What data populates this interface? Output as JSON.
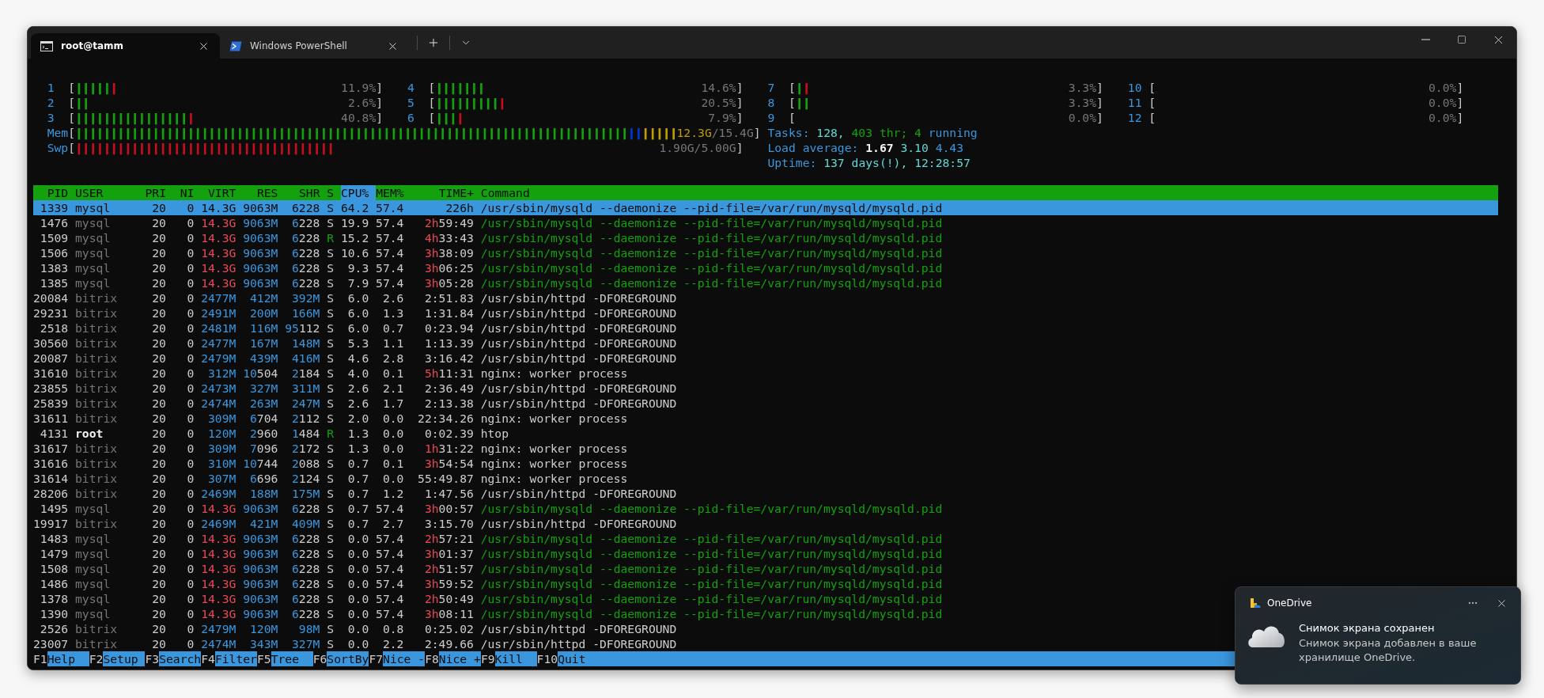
{
  "tabs": [
    {
      "title": "root@tamm",
      "kind": "cmd",
      "selected": true
    },
    {
      "title": "Windows PowerShell",
      "kind": "powershell",
      "selected": false
    }
  ],
  "meter_panels": [
    {
      "cpus": [
        {
          "label": "1",
          "open": "[",
          "close": "]",
          "reading": "11.9%",
          "segments": [
            {
              "color": "#13a10e",
              "text": "|||||"
            },
            {
              "color": "#c50f1f",
              "text": "|"
            }
          ]
        },
        {
          "label": "2",
          "open": "[",
          "close": "]",
          "reading": "2.6%",
          "segments": [
            {
              "color": "#13a10e",
              "text": "||"
            }
          ]
        },
        {
          "label": "3",
          "open": "[",
          "close": "]",
          "reading": "40.8%",
          "segments": [
            {
              "color": "#13a10e",
              "text": "||||||||||||||||"
            },
            {
              "color": "#c50f1f",
              "text": "|"
            }
          ]
        },
        {
          "label": "4",
          "open": "[",
          "close": "]",
          "reading": "14.6%",
          "segments": [
            {
              "color": "#13a10e",
              "text": "|||||||"
            }
          ]
        },
        {
          "label": "5",
          "open": "[",
          "close": "]",
          "reading": "20.5%",
          "segments": [
            {
              "color": "#13a10e",
              "text": "|||||||||"
            },
            {
              "color": "#c50f1f",
              "text": "|"
            }
          ]
        },
        {
          "label": "6",
          "open": "[",
          "close": "]",
          "reading": "7.9%",
          "segments": [
            {
              "color": "#13a10e",
              "text": "|||"
            },
            {
              "color": "#c50f1f",
              "text": "|"
            }
          ]
        }
      ],
      "bars": [
        {
          "label": "Mem",
          "open": "[",
          "close": "]",
          "reading_filled": "12.3G",
          "reading": "/15.4G",
          "segments": [
            {
              "color": "#13a10e",
              "text": "|||||||||||||||||||||||||||||||||||||||||||||||||||||||||||||||||||||||||||||||"
            },
            {
              "color": "#0037da",
              "text": "||"
            },
            {
              "color": "#c19c00",
              "text": "|||||"
            }
          ]
        },
        {
          "label": "Swp",
          "open": "[",
          "close": "]",
          "reading": "1.90G/5.00G",
          "segments": [
            {
              "color": "#c50f1f",
              "text": "|||||||||||||||||||||||||||||||||||||"
            }
          ]
        }
      ]
    },
    {
      "cpus": [
        {
          "label": "7",
          "open": "[",
          "close": "]",
          "reading": "3.3%",
          "segments": [
            {
              "color": "#13a10e",
              "text": "|"
            },
            {
              "color": "#c50f1f",
              "text": "|"
            }
          ]
        },
        {
          "label": "8",
          "open": "[",
          "close": "]",
          "reading": "3.3%",
          "segments": [
            {
              "color": "#13a10e",
              "text": "||"
            }
          ]
        },
        {
          "label": "9",
          "open": "[",
          "close": "]",
          "reading": "0.0%"
        },
        {
          "label": "10",
          "open": "[",
          "close": "]",
          "reading": "0.0%"
        },
        {
          "label": "11",
          "open": "[",
          "close": "]",
          "reading": "0.0%"
        },
        {
          "label": "12",
          "open": "[",
          "close": "]",
          "reading": "0.0%"
        }
      ],
      "summary": [
        {
          "parts": [
            {
              "text": "Tasks:",
              "kind": "label"
            },
            {
              "text": "128,",
              "kind": "value"
            },
            {
              "text": "403 thr;",
              "kind": "accent"
            },
            {
              "text": "4",
              "kind": "accent"
            },
            {
              "text": "running",
              "kind": "label"
            }
          ]
        },
        {
          "parts": [
            {
              "text": "Load average:",
              "kind": "label"
            },
            {
              "text": "1.67",
              "kind": "strong"
            },
            {
              "text": "3.10",
              "kind": "value"
            },
            {
              "text": "4.43",
              "kind": "label"
            }
          ]
        },
        {
          "parts": [
            {
              "text": "Uptime:",
              "kind": "label"
            },
            {
              "text": "137 days(!), 12:28:57",
              "kind": "value"
            }
          ]
        }
      ]
    }
  ],
  "table": {
    "columns": [
      {
        "label": "PID",
        "selected": false
      },
      {
        "label": "USER",
        "selected": false
      },
      {
        "label": "PRI",
        "selected": false
      },
      {
        "label": "NI",
        "selected": false
      },
      {
        "label": "VIRT",
        "selected": false
      },
      {
        "label": "RES",
        "selected": false
      },
      {
        "label": "SHR",
        "selected": false
      },
      {
        "label": "S",
        "selected": false
      },
      {
        "label": "CPU%",
        "selected": true
      },
      {
        "label": "MEM%",
        "selected": false
      },
      {
        "label": "TIME+",
        "selected": false
      },
      {
        "label": "Command",
        "selected": false
      }
    ],
    "rows": [
      {
        "pid": "1339",
        "user": "mysql",
        "pri": "20",
        "ni": "0",
        "virt": "14.3G",
        "res": "9063M",
        "shr": "6228",
        "s": "S",
        "cpu": "64.2",
        "mem": "57.4",
        "time": "226h",
        "command": "/usr/sbin/mysqld --daemonize --pid-file=/var/run/mysqld/mysqld.pid",
        "kind": "process",
        "own": false,
        "running": false,
        "selected": true
      },
      {
        "pid": "1476",
        "user": "mysql",
        "pri": "20",
        "ni": "0",
        "virt": "14.3G",
        "res": "9063M",
        "shr": "6228",
        "s": "S",
        "cpu": "19.9",
        "mem": "57.4",
        "time": "2h59:49",
        "command": "/usr/sbin/mysqld --daemonize --pid-file=/var/run/mysqld/mysqld.pid",
        "kind": "thread",
        "own": false,
        "running": false,
        "selected": false
      },
      {
        "pid": "1509",
        "user": "mysql",
        "pri": "20",
        "ni": "0",
        "virt": "14.3G",
        "res": "9063M",
        "shr": "6228",
        "s": "R",
        "cpu": "15.2",
        "mem": "57.4",
        "time": "4h33:43",
        "command": "/usr/sbin/mysqld --daemonize --pid-file=/var/run/mysqld/mysqld.pid",
        "kind": "thread",
        "own": false,
        "running": true,
        "selected": false
      },
      {
        "pid": "1506",
        "user": "mysql",
        "pri": "20",
        "ni": "0",
        "virt": "14.3G",
        "res": "9063M",
        "shr": "6228",
        "s": "S",
        "cpu": "10.6",
        "mem": "57.4",
        "time": "3h38:09",
        "command": "/usr/sbin/mysqld --daemonize --pid-file=/var/run/mysqld/mysqld.pid",
        "kind": "thread",
        "own": false,
        "running": false,
        "selected": false
      },
      {
        "pid": "1383",
        "user": "mysql",
        "pri": "20",
        "ni": "0",
        "virt": "14.3G",
        "res": "9063M",
        "shr": "6228",
        "s": "S",
        "cpu": "9.3",
        "mem": "57.4",
        "time": "3h06:25",
        "command": "/usr/sbin/mysqld --daemonize --pid-file=/var/run/mysqld/mysqld.pid",
        "kind": "thread",
        "own": false,
        "running": false,
        "selected": false
      },
      {
        "pid": "1385",
        "user": "mysql",
        "pri": "20",
        "ni": "0",
        "virt": "14.3G",
        "res": "9063M",
        "shr": "6228",
        "s": "S",
        "cpu": "7.9",
        "mem": "57.4",
        "time": "3h05:28",
        "command": "/usr/sbin/mysqld --daemonize --pid-file=/var/run/mysqld/mysqld.pid",
        "kind": "thread",
        "own": false,
        "running": false,
        "selected": false
      },
      {
        "pid": "20084",
        "user": "bitrix",
        "pri": "20",
        "ni": "0",
        "virt": "2477M",
        "res": "412M",
        "shr": "392M",
        "s": "S",
        "cpu": "6.0",
        "mem": "2.6",
        "time": "2:51.83",
        "command": "/usr/sbin/httpd -DFOREGROUND",
        "kind": "process",
        "own": false,
        "running": false,
        "selected": false
      },
      {
        "pid": "29231",
        "user": "bitrix",
        "pri": "20",
        "ni": "0",
        "virt": "2491M",
        "res": "200M",
        "shr": "166M",
        "s": "S",
        "cpu": "6.0",
        "mem": "1.3",
        "time": "1:31.84",
        "command": "/usr/sbin/httpd -DFOREGROUND",
        "kind": "process",
        "own": false,
        "running": false,
        "selected": false
      },
      {
        "pid": "2518",
        "user": "bitrix",
        "pri": "20",
        "ni": "0",
        "virt": "2481M",
        "res": "116M",
        "shr": "95112",
        "s": "S",
        "cpu": "6.0",
        "mem": "0.7",
        "time": "0:23.94",
        "command": "/usr/sbin/httpd -DFOREGROUND",
        "kind": "process",
        "own": false,
        "running": false,
        "selected": false
      },
      {
        "pid": "30560",
        "user": "bitrix",
        "pri": "20",
        "ni": "0",
        "virt": "2477M",
        "res": "167M",
        "shr": "148M",
        "s": "S",
        "cpu": "5.3",
        "mem": "1.1",
        "time": "1:13.39",
        "command": "/usr/sbin/httpd -DFOREGROUND",
        "kind": "process",
        "own": false,
        "running": false,
        "selected": false
      },
      {
        "pid": "20087",
        "user": "bitrix",
        "pri": "20",
        "ni": "0",
        "virt": "2479M",
        "res": "439M",
        "shr": "416M",
        "s": "S",
        "cpu": "4.6",
        "mem": "2.8",
        "time": "3:16.42",
        "command": "/usr/sbin/httpd -DFOREGROUND",
        "kind": "process",
        "own": false,
        "running": false,
        "selected": false
      },
      {
        "pid": "31610",
        "user": "bitrix",
        "pri": "20",
        "ni": "0",
        "virt": "312M",
        "res": "10504",
        "shr": "2184",
        "s": "S",
        "cpu": "4.0",
        "mem": "0.1",
        "time": "5h11:31",
        "command": "nginx: worker process",
        "kind": "process",
        "own": false,
        "running": false,
        "selected": false
      },
      {
        "pid": "23855",
        "user": "bitrix",
        "pri": "20",
        "ni": "0",
        "virt": "2473M",
        "res": "327M",
        "shr": "311M",
        "s": "S",
        "cpu": "2.6",
        "mem": "2.1",
        "time": "2:36.49",
        "command": "/usr/sbin/httpd -DFOREGROUND",
        "kind": "process",
        "own": false,
        "running": false,
        "selected": false
      },
      {
        "pid": "25839",
        "user": "bitrix",
        "pri": "20",
        "ni": "0",
        "virt": "2474M",
        "res": "263M",
        "shr": "247M",
        "s": "S",
        "cpu": "2.6",
        "mem": "1.7",
        "time": "2:13.38",
        "command": "/usr/sbin/httpd -DFOREGROUND",
        "kind": "process",
        "own": false,
        "running": false,
        "selected": false
      },
      {
        "pid": "31611",
        "user": "bitrix",
        "pri": "20",
        "ni": "0",
        "virt": "309M",
        "res": "6704",
        "shr": "2112",
        "s": "S",
        "cpu": "2.0",
        "mem": "0.0",
        "time": "22:34.26",
        "command": "nginx: worker process",
        "kind": "process",
        "own": false,
        "running": false,
        "selected": false
      },
      {
        "pid": "4131",
        "user": "root",
        "pri": "20",
        "ni": "0",
        "virt": "120M",
        "res": "2960",
        "shr": "1484",
        "s": "R",
        "cpu": "1.3",
        "mem": "0.0",
        "time": "0:02.39",
        "command": "htop",
        "kind": "process",
        "own": true,
        "running": true,
        "selected": false
      },
      {
        "pid": "31617",
        "user": "bitrix",
        "pri": "20",
        "ni": "0",
        "virt": "309M",
        "res": "7096",
        "shr": "2172",
        "s": "S",
        "cpu": "1.3",
        "mem": "0.0",
        "time": "1h31:22",
        "command": "nginx: worker process",
        "kind": "process",
        "own": false,
        "running": false,
        "selected": false
      },
      {
        "pid": "31616",
        "user": "bitrix",
        "pri": "20",
        "ni": "0",
        "virt": "310M",
        "res": "10744",
        "shr": "2088",
        "s": "S",
        "cpu": "0.7",
        "mem": "0.1",
        "time": "3h54:54",
        "command": "nginx: worker process",
        "kind": "process",
        "own": false,
        "running": false,
        "selected": false
      },
      {
        "pid": "31614",
        "user": "bitrix",
        "pri": "20",
        "ni": "0",
        "virt": "307M",
        "res": "6696",
        "shr": "2124",
        "s": "S",
        "cpu": "0.7",
        "mem": "0.0",
        "time": "55:49.87",
        "command": "nginx: worker process",
        "kind": "process",
        "own": false,
        "running": false,
        "selected": false
      },
      {
        "pid": "28206",
        "user": "bitrix",
        "pri": "20",
        "ni": "0",
        "virt": "2469M",
        "res": "188M",
        "shr": "175M",
        "s": "S",
        "cpu": "0.7",
        "mem": "1.2",
        "time": "1:47.56",
        "command": "/usr/sbin/httpd -DFOREGROUND",
        "kind": "process",
        "own": false,
        "running": false,
        "selected": false
      },
      {
        "pid": "1495",
        "user": "mysql",
        "pri": "20",
        "ni": "0",
        "virt": "14.3G",
        "res": "9063M",
        "shr": "6228",
        "s": "S",
        "cpu": "0.7",
        "mem": "57.4",
        "time": "3h00:57",
        "command": "/usr/sbin/mysqld --daemonize --pid-file=/var/run/mysqld/mysqld.pid",
        "kind": "thread",
        "own": false,
        "running": false,
        "selected": false
      },
      {
        "pid": "19917",
        "user": "bitrix",
        "pri": "20",
        "ni": "0",
        "virt": "2469M",
        "res": "421M",
        "shr": "409M",
        "s": "S",
        "cpu": "0.7",
        "mem": "2.7",
        "time": "3:15.70",
        "command": "/usr/sbin/httpd -DFOREGROUND",
        "kind": "process",
        "own": false,
        "running": false,
        "selected": false
      },
      {
        "pid": "1483",
        "user": "mysql",
        "pri": "20",
        "ni": "0",
        "virt": "14.3G",
        "res": "9063M",
        "shr": "6228",
        "s": "S",
        "cpu": "0.0",
        "mem": "57.4",
        "time": "2h57:21",
        "command": "/usr/sbin/mysqld --daemonize --pid-file=/var/run/mysqld/mysqld.pid",
        "kind": "thread",
        "own": false,
        "running": false,
        "selected": false
      },
      {
        "pid": "1479",
        "user": "mysql",
        "pri": "20",
        "ni": "0",
        "virt": "14.3G",
        "res": "9063M",
        "shr": "6228",
        "s": "S",
        "cpu": "0.0",
        "mem": "57.4",
        "time": "3h01:37",
        "command": "/usr/sbin/mysqld --daemonize --pid-file=/var/run/mysqld/mysqld.pid",
        "kind": "thread",
        "own": false,
        "running": false,
        "selected": false
      },
      {
        "pid": "1508",
        "user": "mysql",
        "pri": "20",
        "ni": "0",
        "virt": "14.3G",
        "res": "9063M",
        "shr": "6228",
        "s": "S",
        "cpu": "0.0",
        "mem": "57.4",
        "time": "2h51:57",
        "command": "/usr/sbin/mysqld --daemonize --pid-file=/var/run/mysqld/mysqld.pid",
        "kind": "thread",
        "own": false,
        "running": false,
        "selected": false
      },
      {
        "pid": "1486",
        "user": "mysql",
        "pri": "20",
        "ni": "0",
        "virt": "14.3G",
        "res": "9063M",
        "shr": "6228",
        "s": "S",
        "cpu": "0.0",
        "mem": "57.4",
        "time": "3h59:52",
        "command": "/usr/sbin/mysqld --daemonize --pid-file=/var/run/mysqld/mysqld.pid",
        "kind": "thread",
        "own": false,
        "running": false,
        "selected": false
      },
      {
        "pid": "1378",
        "user": "mysql",
        "pri": "20",
        "ni": "0",
        "virt": "14.3G",
        "res": "9063M",
        "shr": "6228",
        "s": "S",
        "cpu": "0.0",
        "mem": "57.4",
        "time": "2h50:49",
        "command": "/usr/sbin/mysqld --daemonize --pid-file=/var/run/mysqld/mysqld.pid",
        "kind": "thread",
        "own": false,
        "running": false,
        "selected": false
      },
      {
        "pid": "1390",
        "user": "mysql",
        "pri": "20",
        "ni": "0",
        "virt": "14.3G",
        "res": "9063M",
        "shr": "6228",
        "s": "S",
        "cpu": "0.0",
        "mem": "57.4",
        "time": "3h08:11",
        "command": "/usr/sbin/mysqld --daemonize --pid-file=/var/run/mysqld/mysqld.pid",
        "kind": "thread",
        "own": false,
        "running": false,
        "selected": false
      },
      {
        "pid": "2526",
        "user": "bitrix",
        "pri": "20",
        "ni": "0",
        "virt": "2479M",
        "res": "120M",
        "shr": "98M",
        "s": "S",
        "cpu": "0.0",
        "mem": "0.8",
        "time": "0:25.02",
        "command": "/usr/sbin/httpd -DFOREGROUND",
        "kind": "process",
        "own": false,
        "running": false,
        "selected": false
      },
      {
        "pid": "23007",
        "user": "bitrix",
        "pri": "20",
        "ni": "0",
        "virt": "2474M",
        "res": "343M",
        "shr": "327M",
        "s": "S",
        "cpu": "0.0",
        "mem": "2.2",
        "time": "2:49.66",
        "command": "/usr/sbin/httpd -DFOREGROUND",
        "kind": "process",
        "own": false,
        "running": false,
        "selected": false
      }
    ]
  },
  "function_keys": [
    {
      "key": "F1",
      "label": "Help"
    },
    {
      "key": "F2",
      "label": "Setup"
    },
    {
      "key": "F3",
      "label": "Search"
    },
    {
      "key": "F4",
      "label": "Filter"
    },
    {
      "key": "F5",
      "label": "Tree"
    },
    {
      "key": "F6",
      "label": "SortBy"
    },
    {
      "key": "F7",
      "label": "Nice -"
    },
    {
      "key": "F8",
      "label": "Nice +"
    },
    {
      "key": "F9",
      "label": "Kill"
    },
    {
      "key": "F10",
      "label": "Quit"
    }
  ],
  "notification": {
    "app": "OneDrive",
    "title": "Снимок экрана сохранен",
    "body": "Снимок экрана добавлен в ваше хранилище OneDrive."
  }
}
